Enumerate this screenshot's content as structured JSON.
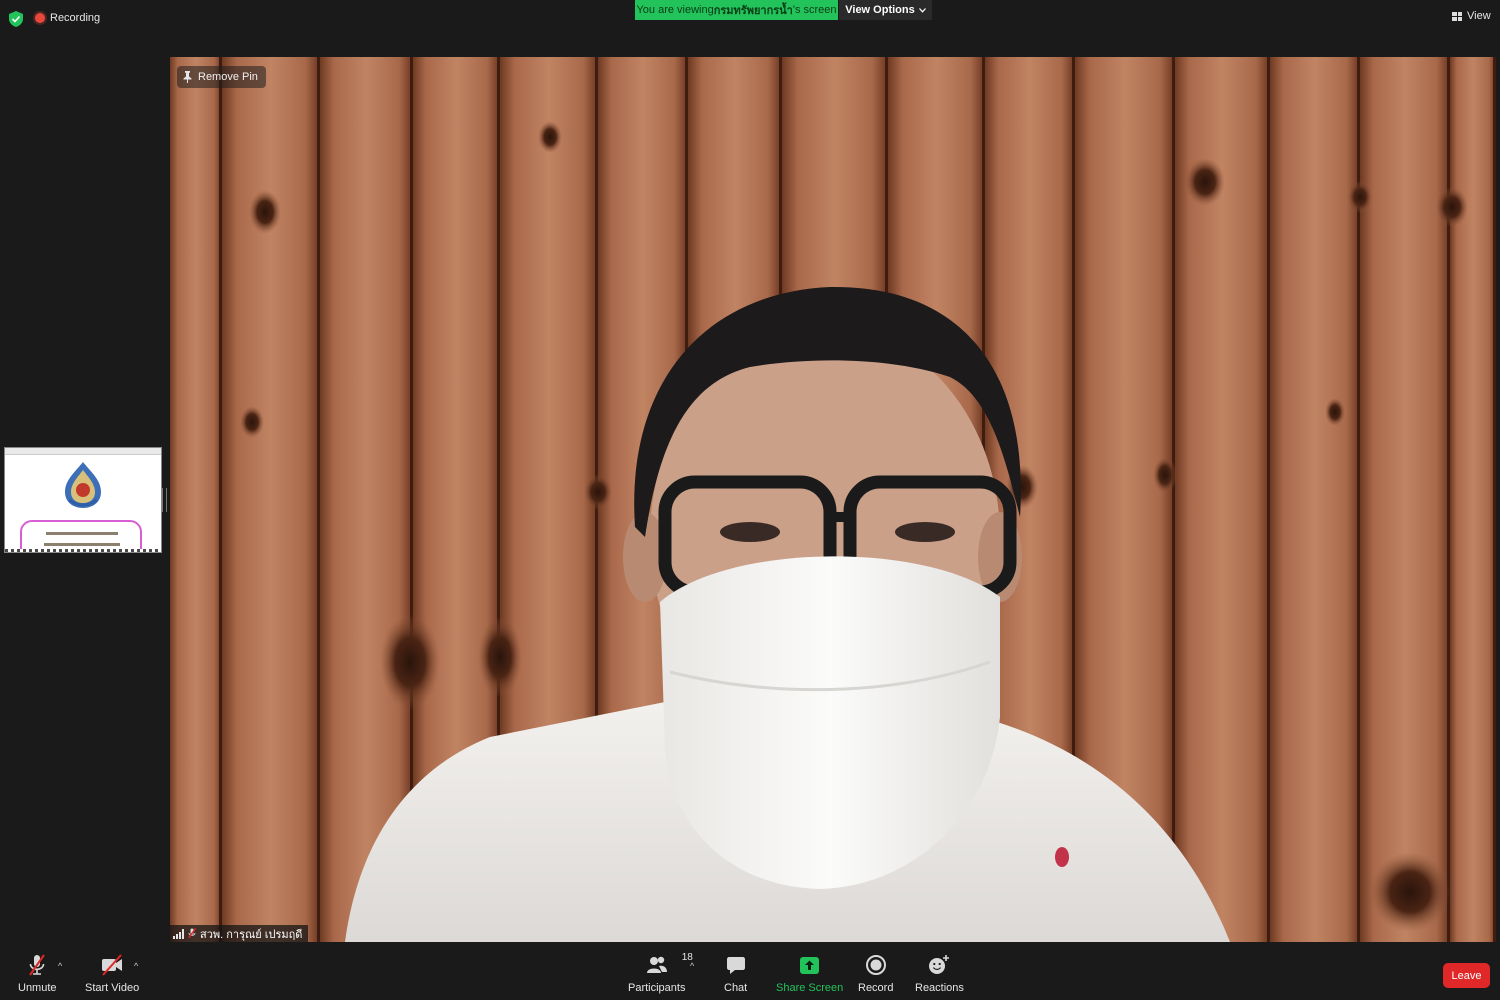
{
  "topbar": {
    "recording_label": "Recording",
    "viewing_prefix": "You are viewing ",
    "viewing_name": "กรมทรัพยากรน้ำ",
    "viewing_suffix": "'s screen",
    "view_options_label": "View Options",
    "view_label": "View"
  },
  "video": {
    "remove_pin_label": "Remove Pin",
    "participant_name": "สวพ. การุณย์ เปรมฤดี"
  },
  "toolbar": {
    "unmute_label": "Unmute",
    "start_video_label": "Start Video",
    "participants_label": "Participants",
    "participants_count": "18",
    "chat_label": "Chat",
    "share_screen_label": "Share Screen",
    "record_label": "Record",
    "reactions_label": "Reactions",
    "leave_label": "Leave"
  },
  "colors": {
    "accent_green": "#23c35b",
    "leave_red": "#e02828",
    "recording_red": "#e8473c"
  },
  "icons": [
    "shield-icon",
    "recording-dot-icon",
    "chevron-down-icon",
    "grid-view-icon",
    "pin-icon",
    "signal-icon",
    "mic-muted-icon",
    "video-off-icon",
    "participants-icon",
    "chat-icon",
    "share-screen-icon",
    "record-icon",
    "reactions-icon"
  ]
}
